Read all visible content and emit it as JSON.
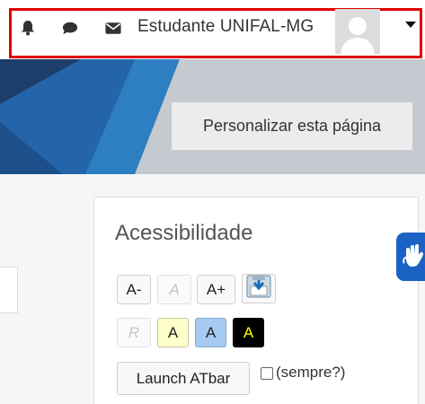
{
  "navbar": {
    "icons": [
      "bell-icon",
      "chat-icon",
      "envelope-icon"
    ],
    "user_name": "Estudante UNIFAL-MG",
    "highlight_color": "#e00000"
  },
  "header": {
    "customize_label": "Personalizar esta página",
    "banner_colors": [
      "#1b3e6a",
      "#2e7fc1",
      "#c4c9cf"
    ]
  },
  "accessibility": {
    "title": "Acessibilidade",
    "row1": [
      "A-",
      "A",
      "A+"
    ],
    "row2": [
      "R",
      "A",
      "A",
      "A"
    ],
    "row2_colors": [
      "#fafafa",
      "#ffffcc",
      "#a6cbf2",
      "#000000"
    ],
    "launch_label": "Launch ATbar",
    "always_label": "(sempre?)",
    "always_checked": false
  },
  "side_widget": {
    "icon": "hands-sign-language-icon",
    "color": "#1a63c4"
  }
}
